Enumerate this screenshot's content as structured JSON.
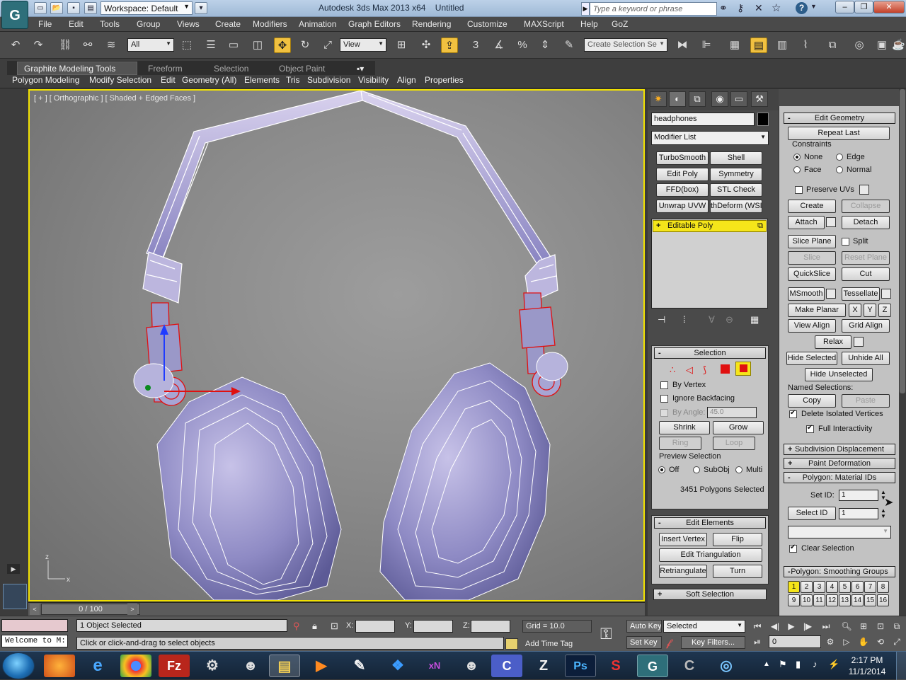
{
  "titlebar": {
    "workspace": "Workspace: Default",
    "title": "Autodesk 3ds Max 2013 x64",
    "file": "Untitled",
    "search_placeholder": "Type a keyword or phrase"
  },
  "menu": [
    "File",
    "Edit",
    "Tools",
    "Group",
    "Views",
    "Create",
    "Modifiers",
    "Animation",
    "Graph Editors",
    "Rendering",
    "Customize",
    "MAXScript",
    "Help",
    "GoZ"
  ],
  "toolbar": {
    "selection_filter": "All",
    "ref_coord": "View",
    "selection_set_placeholder": "Create Selection Se"
  },
  "ribbon": {
    "tabs": [
      "Graphite Modeling Tools",
      "Freeform",
      "Selection",
      "Object Paint"
    ],
    "subtabs": [
      "Polygon Modeling",
      "Modify Selection",
      "Edit",
      "Geometry (All)",
      "Elements",
      "Tris",
      "Subdivision",
      "Visibility",
      "Align",
      "Properties"
    ]
  },
  "viewport": {
    "label": "[ + ] [ Orthographic ] [ Shaded + Edged Faces ]",
    "axis_x": "x",
    "axis_z": "z"
  },
  "command_panel": {
    "object_name": "headphones",
    "modifier_list": "Modifier List",
    "mod_buttons": [
      "TurboSmooth",
      "Shell",
      "Edit Poly",
      "Symmetry",
      "FFD(box)",
      "STL Check",
      "Unwrap UVW",
      "thDeform (WSI"
    ],
    "stack_item": "Editable Poly",
    "selection": {
      "title": "Selection",
      "by_vertex": "By Vertex",
      "ignore_backfacing": "Ignore Backfacing",
      "by_angle": "By Angle:",
      "angle_value": "45.0",
      "shrink": "Shrink",
      "grow": "Grow",
      "ring": "Ring",
      "loop": "Loop",
      "preview_title": "Preview Selection",
      "off": "Off",
      "subobj": "SubObj",
      "multi": "Multi",
      "status": "3451 Polygons Selected"
    },
    "edit_elements": {
      "title": "Edit Elements",
      "insert_vertex": "Insert Vertex",
      "flip": "Flip",
      "edit_triangulation": "Edit Triangulation",
      "retriangulate": "Retriangulate",
      "turn": "Turn"
    },
    "soft_selection": "Soft Selection"
  },
  "right_panel": {
    "edit_geometry": "Edit Geometry",
    "repeat_last": "Repeat Last",
    "constraints": "Constraints",
    "none": "None",
    "edge": "Edge",
    "face": "Face",
    "normal": "Normal",
    "preserve_uvs": "Preserve UVs",
    "create": "Create",
    "collapse": "Collapse",
    "attach": "Attach",
    "detach": "Detach",
    "slice_plane": "Slice Plane",
    "split": "Split",
    "slice": "Slice",
    "reset_plane": "Reset Plane",
    "quickslice": "QuickSlice",
    "cut": "Cut",
    "msmooth": "MSmooth",
    "tessellate": "Tessellate",
    "make_planar": "Make Planar",
    "x": "X",
    "y": "Y",
    "z": "Z",
    "view_align": "View Align",
    "grid_align": "Grid Align",
    "relax": "Relax",
    "hide_selected": "Hide Selected",
    "unhide_all": "Unhide All",
    "hide_unselected": "Hide Unselected",
    "named_selections": "Named Selections:",
    "copy": "Copy",
    "paste": "Paste",
    "delete_isolated": "Delete Isolated Vertices",
    "full_interactivity": "Full Interactivity",
    "subdivision_displacement": "Subdivision Displacement",
    "paint_deformation": "Paint Deformation",
    "material_ids": "Polygon: Material IDs",
    "set_id": "Set ID:",
    "set_id_value": "1",
    "select_id": "Select ID",
    "select_id_value": "1",
    "clear_selection": "Clear Selection",
    "smoothing_groups": "Polygon: Smoothing Groups",
    "sg_row1": [
      "1",
      "2",
      "3",
      "4",
      "5",
      "6",
      "7",
      "8"
    ],
    "sg_row2": [
      "9",
      "10",
      "11",
      "12",
      "13",
      "14",
      "15",
      "16"
    ]
  },
  "timeline": {
    "frame": "0 / 100"
  },
  "status": {
    "selected": "1 Object Selected",
    "prompt": "Click or click-and-drag to select objects",
    "listener": "Welcome to M:",
    "x_label": "X:",
    "y_label": "Y:",
    "z_label": "Z:",
    "grid": "Grid = 10.0",
    "add_time_tag": "Add Time Tag",
    "auto_key": "Auto Key",
    "set_key": "Set Key",
    "key_mode": "Selected",
    "key_filters": "Key Filters...",
    "frame_field": "0"
  },
  "taskbar": {
    "apps": [
      "firefox",
      "ie",
      "chrome",
      "filezilla",
      "app5",
      "app6",
      "explorer",
      "media",
      "app9",
      "dropbox",
      "xn",
      "app12",
      "app13",
      "zbrush",
      "photoshop",
      "substance",
      "3dsmax",
      "app18",
      "app19"
    ],
    "time": "2:17 PM",
    "date": "11/1/2014"
  },
  "colors": {
    "accent": "#f2e200",
    "stack_highlight": "#f5e51a",
    "selection_red": "#e01010"
  }
}
